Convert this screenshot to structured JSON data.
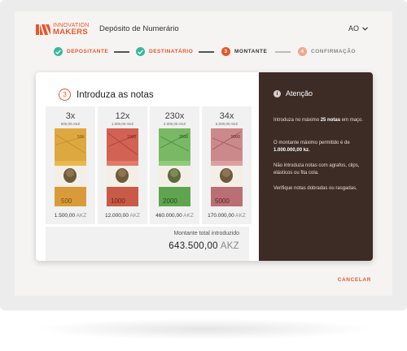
{
  "header": {
    "logo": {
      "line1": "INNOVATION",
      "line2": "MAKERS"
    },
    "title": "Depósito de Numerário",
    "language": "AO"
  },
  "stepper": [
    {
      "num": "1",
      "label": "DEPOSITANTE",
      "state": "done"
    },
    {
      "num": "2",
      "label": "DESTINATÁRIO",
      "state": "done"
    },
    {
      "num": "3",
      "label": "MONTANTE",
      "state": "active"
    },
    {
      "num": "4",
      "label": "CONFIRMAÇÃO",
      "state": "pending"
    }
  ],
  "section": {
    "num": "3",
    "title": "Introduza as notas"
  },
  "notes": [
    {
      "count": "3x",
      "face": "500,00 AKZ",
      "amount": "1.500,00",
      "currency": "AKZ",
      "denom": "500",
      "colors": [
        "#e9b94e",
        "#c98a2a"
      ]
    },
    {
      "count": "12x",
      "face": "1.000,00 AKZ",
      "amount": "12.000,00",
      "currency": "AKZ",
      "denom": "1000",
      "colors": [
        "#e47a6b",
        "#b6432f"
      ]
    },
    {
      "count": "230x",
      "face": "2.000,00 AKZ",
      "amount": "460.000,00",
      "currency": "AKZ",
      "denom": "2000",
      "colors": [
        "#7fbf6a",
        "#3f8a3a"
      ]
    },
    {
      "count": "34x",
      "face": "5.000,00 AKZ",
      "amount": "170.000,00",
      "currency": "AKZ",
      "denom": "5000",
      "colors": [
        "#d98a8c",
        "#8e4a50"
      ]
    }
  ],
  "total": {
    "label": "Montante total introduzido",
    "value": "643.500,00",
    "currency": "AKZ"
  },
  "attention": {
    "title": "Atenção",
    "p1_pre": "Introduza no máximo ",
    "p1_bold": "25 notas",
    "p1_post": " em maço.",
    "p2_pre": "O montante máximo permitido é de ",
    "p2_bold": "1.000.000,00 kz.",
    "p3": "Não introduza notas com agrafos, clips, elásticos ou fita cola.",
    "p4": "Verifique notas dobradas ou rasgadas."
  },
  "cancel_label": "CANCELAR",
  "colors": {
    "accent": "#e8562a",
    "done": "#3bb89b",
    "panel": "#3d2b26"
  }
}
